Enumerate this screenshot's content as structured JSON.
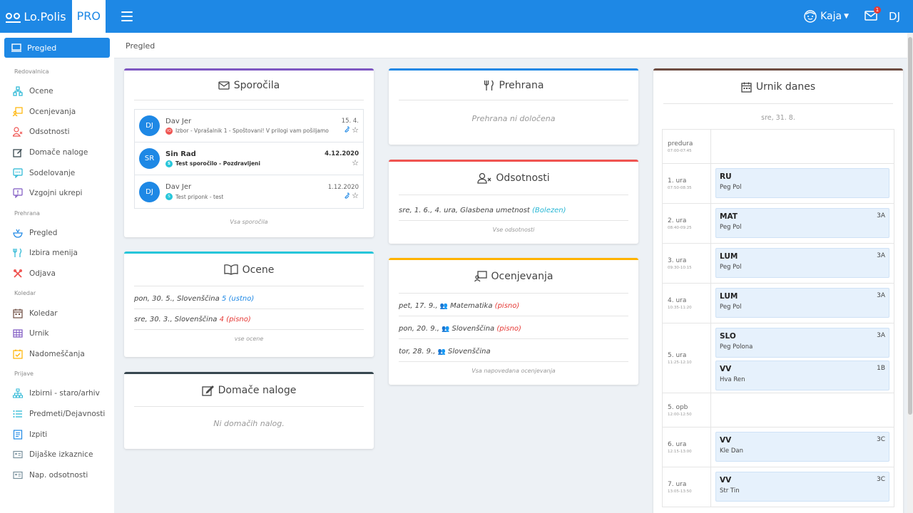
{
  "header": {
    "brand_name": "Lo.Polis",
    "brand_pro": "PRO",
    "user_name": "Kaja",
    "mail_badge": "1",
    "initials": "DJ"
  },
  "breadcrumb": "Pregled",
  "sidebar": {
    "active": "Pregled",
    "sections": [
      {
        "title": "Redovalnica",
        "items": [
          "Ocene",
          "Ocenjevanja",
          "Odsotnosti",
          "Domače naloge",
          "Sodelovanje",
          "Vzgojni ukrepi"
        ]
      },
      {
        "title": "Prehrana",
        "items": [
          "Pregled",
          "Izbira menija",
          "Odjava"
        ]
      },
      {
        "title": "Koledar",
        "items": [
          "Koledar",
          "Urnik",
          "Nadomeščanja"
        ]
      },
      {
        "title": "Prijave",
        "items": [
          "Izbirni - staro/arhiv",
          "Predmeti/Dejavnosti",
          "Izpiti",
          "Dijaške izkaznice",
          "Nap. odsotnosti"
        ]
      }
    ]
  },
  "messages": {
    "title": "Sporočila",
    "items": [
      {
        "initials": "DJ",
        "from": "Dav Jer",
        "date": "15. 4.",
        "tag": "IO",
        "subject": "Izbor - Vprašalnik 1 - Spoštovani! V prilogi vam pošiljamo",
        "bold": false
      },
      {
        "initials": "SR",
        "from": "Sin Rad",
        "date": "4.12.2020",
        "tag": "S",
        "subject": "Test sporočilo - Pozdravljeni",
        "bold": true
      },
      {
        "initials": "DJ",
        "from": "Dav Jer",
        "date": "1.12.2020",
        "tag": "S",
        "subject": "Test priponk - test",
        "bold": false
      }
    ],
    "footer": "Vsa sporočila"
  },
  "grades": {
    "title": "Ocene",
    "items": [
      {
        "text": "pon, 30. 5., Slovenščina ",
        "grade": "5",
        "type": "(ustno)"
      },
      {
        "text": "sre, 30. 3., Slovenščina ",
        "grade": "4",
        "type": "(pisno)"
      }
    ],
    "footer": "vse ocene"
  },
  "homework": {
    "title": "Domače naloge",
    "empty": "Ni domačih nalog."
  },
  "meals": {
    "title": "Prehrana",
    "empty": "Prehrana ni določena"
  },
  "absences": {
    "title": "Odsotnosti",
    "items": [
      {
        "text": "sre, 1. 6., 4. ura, Glasbena umetnost ",
        "reason": "(Bolezen)"
      }
    ],
    "footer": "Vse odsotnosti"
  },
  "assessments": {
    "title": "Ocenjevanja",
    "items": [
      {
        "date": "pet, 17. 9., ",
        "subject": " Matematika ",
        "type": "(pisno)"
      },
      {
        "date": "pon, 20. 9., ",
        "subject": " Slovenščina ",
        "type": "(pisno)"
      },
      {
        "date": "tor, 28. 9., ",
        "subject": " Slovenščina",
        "type": ""
      }
    ],
    "footer": "Vsa napovedana ocenjevanja"
  },
  "schedule": {
    "title": "Urnik danes",
    "date": "sre, 31. 8.",
    "rows": [
      {
        "name": "predura",
        "time": "07:00-07:45",
        "lessons": []
      },
      {
        "name": "1. ura",
        "time": "07:50-08:35",
        "lessons": [
          {
            "subject": "RU",
            "room": "",
            "teacher": "Peg Pol"
          }
        ]
      },
      {
        "name": "2. ura",
        "time": "08:40-09:25",
        "lessons": [
          {
            "subject": "MAT",
            "room": "3A",
            "teacher": "Peg Pol"
          }
        ]
      },
      {
        "name": "3. ura",
        "time": "09:30-10:15",
        "lessons": [
          {
            "subject": "LUM",
            "room": "3A",
            "teacher": "Peg Pol"
          }
        ]
      },
      {
        "name": "4. ura",
        "time": "10:35-11:20",
        "lessons": [
          {
            "subject": "LUM",
            "room": "3A",
            "teacher": "Peg Pol"
          }
        ]
      },
      {
        "name": "5. ura",
        "time": "11:25-12:10",
        "lessons": [
          {
            "subject": "SLO",
            "room": "3A",
            "teacher": "Peg Polona"
          },
          {
            "subject": "VV",
            "room": "1B",
            "teacher": "Hva Ren"
          }
        ]
      },
      {
        "name": "5. opb",
        "time": "12:00-12:50",
        "lessons": []
      },
      {
        "name": "6. ura",
        "time": "12:15-13:00",
        "lessons": [
          {
            "subject": "VV",
            "room": "3C",
            "teacher": "Kle Dan"
          }
        ]
      },
      {
        "name": "7. ura",
        "time": "13:05-13:50",
        "lessons": [
          {
            "subject": "VV",
            "room": "3C",
            "teacher": "Str Tin"
          }
        ]
      }
    ]
  },
  "colors": {
    "primary": "#1e88e5",
    "messages_border": "#7e57c2",
    "grades_border": "#26c6da",
    "homework_border": "#37474f",
    "meals_border": "#1e88e5",
    "absences_border": "#ef5350",
    "assessments_border": "#ffb300",
    "schedule_border": "#6d4c41"
  }
}
